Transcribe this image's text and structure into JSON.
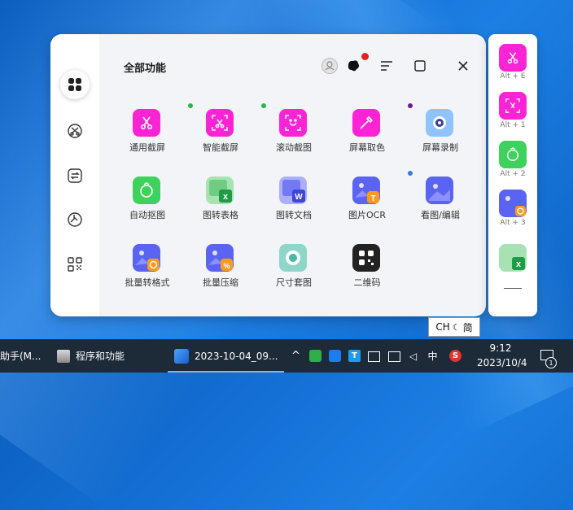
{
  "panel": {
    "title": "全部功能",
    "header_icons": [
      "avatar-icon",
      "skin-icon",
      "sort-icon",
      "window-icon",
      "close-icon"
    ],
    "rail_icons": [
      "all-features-icon",
      "scissor-circle-icon",
      "convert-icon",
      "palette-icon",
      "apps-icon"
    ],
    "tiles": [
      {
        "label": "通用截屏",
        "color": "#ff23d6"
      },
      {
        "label": "智能截屏",
        "color": "#ff23d6"
      },
      {
        "label": "滚动截图",
        "color": "#ff23d6"
      },
      {
        "label": "屏幕取色",
        "color": "#ff23d6"
      },
      {
        "label": "屏幕录制",
        "color": "#8ec3ff"
      },
      {
        "label": "自动抠图",
        "color": "#3ed25d"
      },
      {
        "label": "图转表格",
        "color": "#55c56d"
      },
      {
        "label": "图转文档",
        "color": "#5b63f2"
      },
      {
        "label": "图片OCR",
        "color": "#5b63f2"
      },
      {
        "label": "看图/编辑",
        "color": "#5b63f2"
      },
      {
        "label": "批量转格式",
        "color": "#5b63f2"
      },
      {
        "label": "批量压缩",
        "color": "#5b63f2"
      },
      {
        "label": "尺寸套图",
        "color": "#47b8a5"
      },
      {
        "label": "二维码",
        "color": "#222222"
      }
    ]
  },
  "quickbar": {
    "items": [
      {
        "shortcut": "Alt + E"
      },
      {
        "shortcut": "Alt + 1"
      },
      {
        "shortcut": "Alt + 2"
      },
      {
        "shortcut": "Alt + 3"
      }
    ]
  },
  "tooltip": {
    "lang": "CH",
    "mode": "简"
  },
  "taskbar": {
    "item1": "助手(M...",
    "item2": "程序和功能",
    "item3": "2023-10-04_09...",
    "tray_ime": "中",
    "time": "9:12",
    "date": "2023/10/4",
    "notify_count": "1"
  },
  "colors": {
    "accent_pink": "#ff23d6",
    "dot_green": "#22b84c",
    "dot_purple": "#6b1d8f",
    "dot_blue": "#3a78d8",
    "badge_red": "#e52222"
  }
}
